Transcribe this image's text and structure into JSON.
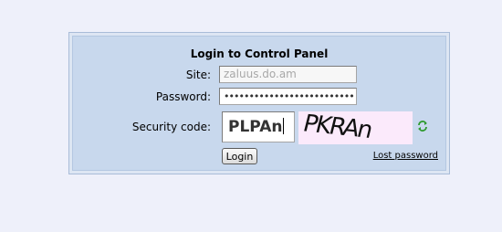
{
  "panel": {
    "title": "Login to Control Panel",
    "site_label": "Site:",
    "site_value": "zaluus.do.am",
    "password_label": "Password:",
    "password_masked": "••••••••••••••••••••••••••",
    "security_label": "Security code:",
    "security_value": "PLPAn",
    "captcha_text": "PKRAn",
    "refresh_icon": "refresh-arrows-icon",
    "login_label": "Login",
    "lost_password_label": "Lost password"
  },
  "colors": {
    "page_bg": "#eef0fa",
    "panel_bg": "#c8d8ed",
    "captcha_bg": "#fbeafb",
    "refresh_green": "#2e9a2e"
  }
}
